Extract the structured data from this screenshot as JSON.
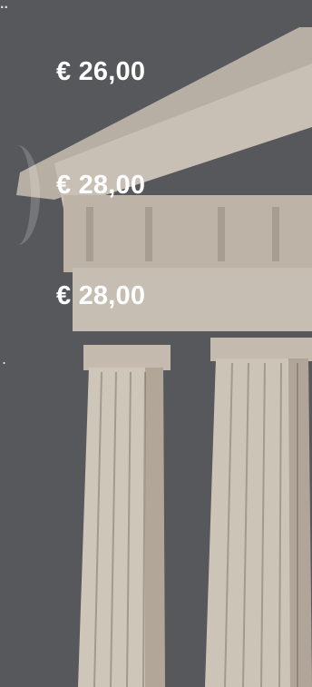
{
  "prices": [
    {
      "label": "€ 26,00"
    },
    {
      "label": "€ 28,00"
    },
    {
      "label": "€ 28,00"
    }
  ],
  "decor": {
    "top_glyph": "..",
    "left_glyph": "."
  },
  "colors": {
    "background": "#57585c",
    "stone": "#c8bfb3",
    "text": "#ffffff"
  }
}
